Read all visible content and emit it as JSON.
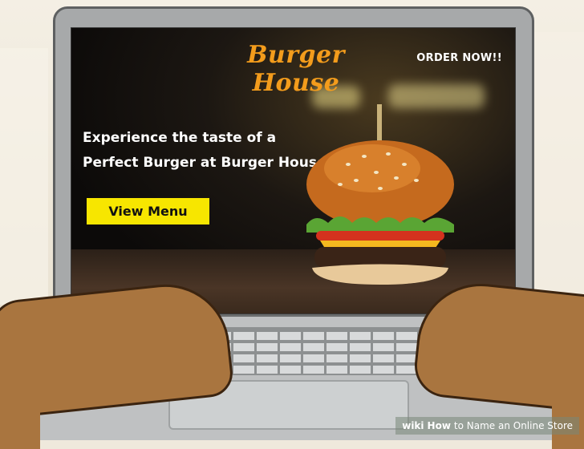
{
  "website": {
    "brand_name": "Burger House",
    "order_link": "ORDER NOW!!",
    "hero_line_1": "Experience the taste of a",
    "hero_line_2": "Perfect Burger at Burger House",
    "menu_button": "View Menu"
  },
  "watermark": {
    "prefix": "wiki",
    "emphasis": "How",
    "rest": "to Name an Online Store"
  },
  "colors": {
    "brand_orange": "#f39c1c",
    "button_yellow": "#f7e600",
    "screen_dark": "#0d0b0a",
    "skin": "#a9753f"
  }
}
